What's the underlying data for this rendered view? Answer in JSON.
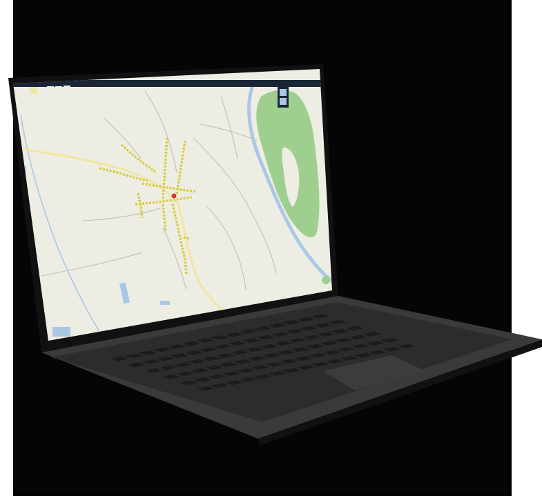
{
  "scene": {
    "subject": "laptop",
    "screen_content": "map-application"
  },
  "palette": {
    "background": "#050505",
    "frame": "#ffffff",
    "laptop_body": "#3a3a3a",
    "keyboard_deck": "#2c2c2c",
    "key": "#1c1c1c",
    "touchpad": "#3c3c3c",
    "bezel": "#111111",
    "map_land": "#eeede4",
    "map_forest": "#9fcf8f",
    "map_river": "#a9c8e6",
    "map_road": "#c4c2b8",
    "map_highway": "#f0e6a0",
    "map_marker": "#d8cc3a",
    "map_marker_alert": "#d23a2a",
    "map_toolbar": "#1a2636"
  },
  "map": {
    "toolbar_icons": [
      "map-layer-icon",
      "search-icon",
      "settings-icon",
      "print-icon",
      "info-icon"
    ],
    "zoom_controls": [
      "zoom-in-icon",
      "zoom-out-icon"
    ]
  }
}
